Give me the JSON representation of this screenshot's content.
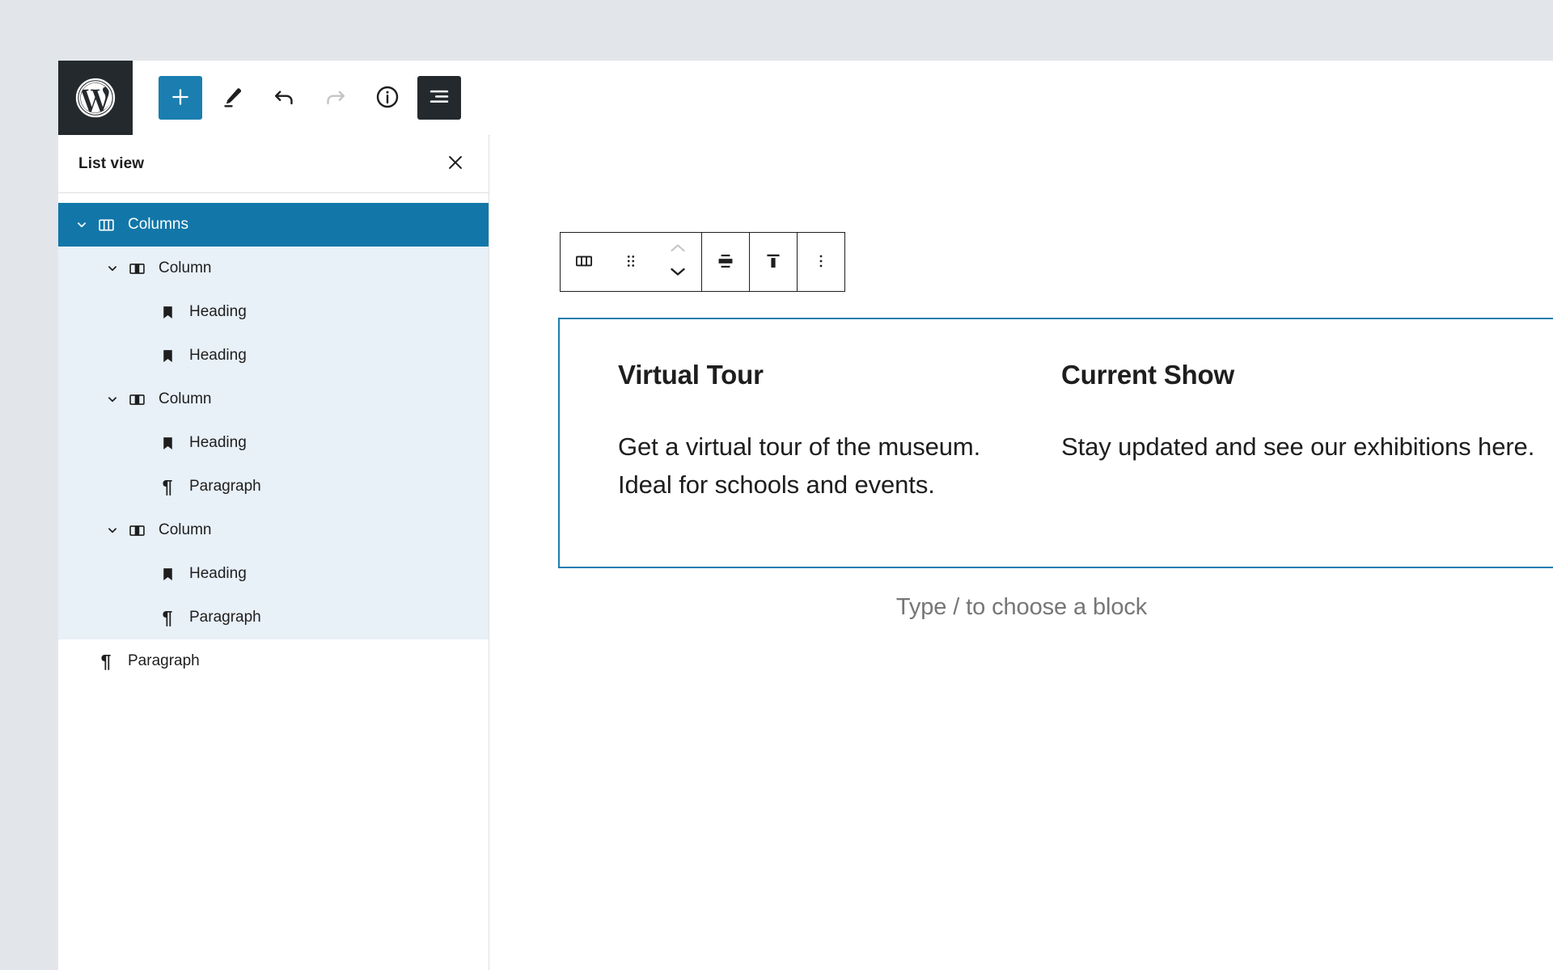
{
  "top_toolbar": {
    "logo_label": "WordPress",
    "buttons": [
      {
        "name": "add-block",
        "label": "Add block",
        "icon": "plus-icon",
        "state": "primary"
      },
      {
        "name": "tools",
        "label": "Tools",
        "icon": "pencil-icon",
        "state": "default"
      },
      {
        "name": "undo",
        "label": "Undo",
        "icon": "undo-icon",
        "state": "default"
      },
      {
        "name": "redo",
        "label": "Redo",
        "icon": "redo-icon",
        "state": "disabled"
      },
      {
        "name": "details",
        "label": "Details",
        "icon": "info-icon",
        "state": "default"
      },
      {
        "name": "list-view",
        "label": "List View",
        "icon": "list-view-icon",
        "state": "active"
      }
    ]
  },
  "list_view": {
    "title": "List view",
    "close_label": "Close",
    "items": [
      {
        "label": "Columns",
        "icon": "columns-icon",
        "indent": 0,
        "expandable": true,
        "selected": true,
        "highlighted": false
      },
      {
        "label": "Column",
        "icon": "column-icon",
        "indent": 1,
        "expandable": true,
        "selected": false,
        "highlighted": true
      },
      {
        "label": "Heading",
        "icon": "heading-icon",
        "indent": 2,
        "expandable": false,
        "selected": false,
        "highlighted": true
      },
      {
        "label": "Heading",
        "icon": "heading-icon",
        "indent": 2,
        "expandable": false,
        "selected": false,
        "highlighted": true
      },
      {
        "label": "Column",
        "icon": "column-icon",
        "indent": 1,
        "expandable": true,
        "selected": false,
        "highlighted": true
      },
      {
        "label": "Heading",
        "icon": "heading-icon",
        "indent": 2,
        "expandable": false,
        "selected": false,
        "highlighted": true
      },
      {
        "label": "Paragraph",
        "icon": "paragraph-icon",
        "indent": 2,
        "expandable": false,
        "selected": false,
        "highlighted": true
      },
      {
        "label": "Column",
        "icon": "column-icon",
        "indent": 1,
        "expandable": true,
        "selected": false,
        "highlighted": true
      },
      {
        "label": "Heading",
        "icon": "heading-icon",
        "indent": 2,
        "expandable": false,
        "selected": false,
        "highlighted": true
      },
      {
        "label": "Paragraph",
        "icon": "paragraph-icon",
        "indent": 2,
        "expandable": false,
        "selected": false,
        "highlighted": true
      },
      {
        "label": "Paragraph",
        "icon": "paragraph-icon",
        "indent": 0,
        "expandable": false,
        "selected": false,
        "highlighted": false
      }
    ]
  },
  "block_toolbar": {
    "buttons": [
      {
        "name": "block-type-columns",
        "label": "Columns",
        "icon": "columns-icon"
      },
      {
        "name": "drag-handle",
        "label": "Drag",
        "icon": "drag-dots-icon"
      },
      {
        "name": "move-up",
        "label": "Move up",
        "icon": "chevron-up-icon",
        "state": "disabled"
      },
      {
        "name": "move-down",
        "label": "Move down",
        "icon": "chevron-down-icon",
        "state": "default"
      },
      {
        "name": "align",
        "label": "Align",
        "icon": "align-center-icon"
      },
      {
        "name": "vertical-align",
        "label": "Change vertical alignment",
        "icon": "vertical-align-top-icon"
      },
      {
        "name": "more-options",
        "label": "Options",
        "icon": "three-dots-vertical-icon"
      }
    ]
  },
  "canvas": {
    "columns": [
      {
        "heading": "Virtual Tour",
        "paragraph": "Get a virtual tour of the museum. Ideal for schools and events."
      },
      {
        "heading": "Current Show",
        "paragraph": "Stay updated and see our exhibitions here."
      }
    ],
    "empty_block_placeholder": "Type / to choose a block"
  },
  "colors": {
    "accent": "#1a7eb0",
    "selected_row": "#1277a8",
    "highlight_row": "#e8f0f8",
    "chrome_dark": "#24292d",
    "page_bg": "#e2e6ea",
    "muted_text": "#767676"
  }
}
